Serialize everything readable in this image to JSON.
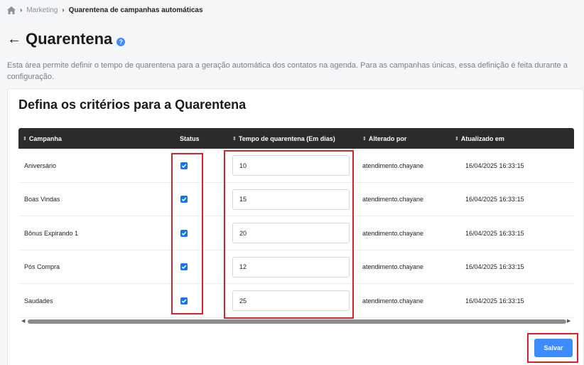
{
  "breadcrumb": {
    "home_icon": "home-icon",
    "items": [
      "Marketing",
      "Quarentena de campanhas automáticas"
    ]
  },
  "page": {
    "title": "Quarentena",
    "help_icon": "?",
    "description": "Esta área permite definir o tempo de quarentena para a geração automática dos contatos na agenda. Para as campanhas únicas, essa definição é feita durante a configuração."
  },
  "card": {
    "title": "Defina os critérios para a Quarentena"
  },
  "table": {
    "columns": {
      "campaign": "Campanha",
      "status": "Status",
      "days": "Tempo de quarentena (Em dias)",
      "changed_by": "Alterado por",
      "updated_at": "Atualizado em"
    },
    "rows": [
      {
        "campaign": "Aniversário",
        "status": true,
        "days": "10",
        "changed_by": "atendimento.chayane",
        "updated_at": "16/04/2025 16:33:15"
      },
      {
        "campaign": "Boas Vindas",
        "status": true,
        "days": "15",
        "changed_by": "atendimento.chayane",
        "updated_at": "16/04/2025 16:33:15"
      },
      {
        "campaign": "Bônus Expirando 1",
        "status": true,
        "days": "20",
        "changed_by": "atendimento.chayane",
        "updated_at": "16/04/2025 16:33:15"
      },
      {
        "campaign": "Pós Compra",
        "status": true,
        "days": "12",
        "changed_by": "atendimento.chayane",
        "updated_at": "16/04/2025 16:33:15"
      },
      {
        "campaign": "Saudades",
        "status": true,
        "days": "25",
        "changed_by": "atendimento.chayane",
        "updated_at": "16/04/2025 16:33:15"
      }
    ]
  },
  "actions": {
    "save_label": "Salvar"
  },
  "colors": {
    "accent": "#3d8bfd",
    "highlight": "#d6242a",
    "header_bg": "#2b2b2b"
  }
}
